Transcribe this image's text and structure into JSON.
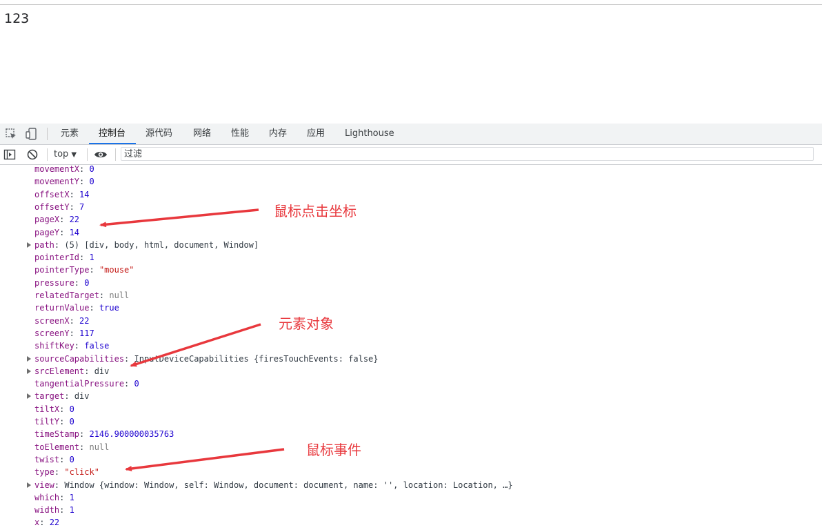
{
  "page": {
    "text": "123"
  },
  "devtools": {
    "tabs": [
      {
        "id": "elements",
        "label": "元素"
      },
      {
        "id": "console",
        "label": "控制台",
        "active": true
      },
      {
        "id": "sources",
        "label": "源代码"
      },
      {
        "id": "network",
        "label": "网络"
      },
      {
        "id": "performance",
        "label": "性能"
      },
      {
        "id": "memory",
        "label": "内存"
      },
      {
        "id": "application",
        "label": "应用"
      },
      {
        "id": "lighthouse",
        "label": "Lighthouse"
      }
    ],
    "toolbar": {
      "context": "top",
      "context_arrow": "▼",
      "filter_placeholder": "过滤"
    }
  },
  "console": {
    "rows": [
      {
        "key": "movementX",
        "value": "0",
        "type": "num"
      },
      {
        "key": "movementY",
        "value": "0",
        "type": "num"
      },
      {
        "key": "offsetX",
        "value": "14",
        "type": "num"
      },
      {
        "key": "offsetY",
        "value": "7",
        "type": "num"
      },
      {
        "key": "pageX",
        "value": "22",
        "type": "num"
      },
      {
        "key": "pageY",
        "value": "14",
        "type": "num"
      },
      {
        "key": "path",
        "value": "(5) [div, body, html, document, Window]",
        "type": "obj",
        "expandable": true
      },
      {
        "key": "pointerId",
        "value": "1",
        "type": "num"
      },
      {
        "key": "pointerType",
        "value": "\"mouse\"",
        "type": "str"
      },
      {
        "key": "pressure",
        "value": "0",
        "type": "num"
      },
      {
        "key": "relatedTarget",
        "value": "null",
        "type": "null"
      },
      {
        "key": "returnValue",
        "value": "true",
        "type": "num"
      },
      {
        "key": "screenX",
        "value": "22",
        "type": "num"
      },
      {
        "key": "screenY",
        "value": "117",
        "type": "num"
      },
      {
        "key": "shiftKey",
        "value": "false",
        "type": "num"
      },
      {
        "key": "sourceCapabilities",
        "value": "InputDeviceCapabilities {firesTouchEvents: false}",
        "type": "obj",
        "expandable": true
      },
      {
        "key": "srcElement",
        "value": "div",
        "type": "obj",
        "expandable": true
      },
      {
        "key": "tangentialPressure",
        "value": "0",
        "type": "num"
      },
      {
        "key": "target",
        "value": "div",
        "type": "obj",
        "expandable": true
      },
      {
        "key": "tiltX",
        "value": "0",
        "type": "num"
      },
      {
        "key": "tiltY",
        "value": "0",
        "type": "num"
      },
      {
        "key": "timeStamp",
        "value": "2146.900000035763",
        "type": "num"
      },
      {
        "key": "toElement",
        "value": "null",
        "type": "null"
      },
      {
        "key": "twist",
        "value": "0",
        "type": "num"
      },
      {
        "key": "type",
        "value": "\"click\"",
        "type": "str"
      },
      {
        "key": "view",
        "value": "Window {window: Window, self: Window, document: document, name: '', location: Location, …}",
        "type": "obj",
        "expandable": true
      },
      {
        "key": "which",
        "value": "1",
        "type": "num"
      },
      {
        "key": "width",
        "value": "1",
        "type": "num"
      },
      {
        "key": "x",
        "value": "22",
        "type": "num"
      }
    ]
  },
  "annotations": {
    "mouse_coords": "鼠标点击坐标",
    "element_object": "元素对象",
    "mouse_event": "鼠标事件"
  },
  "colors": {
    "key": "#881280",
    "number": "#1c00cf",
    "string": "#c41a16",
    "null": "#808080",
    "annotation": "#e8383d",
    "tab_active_underline": "#1a73e8"
  }
}
